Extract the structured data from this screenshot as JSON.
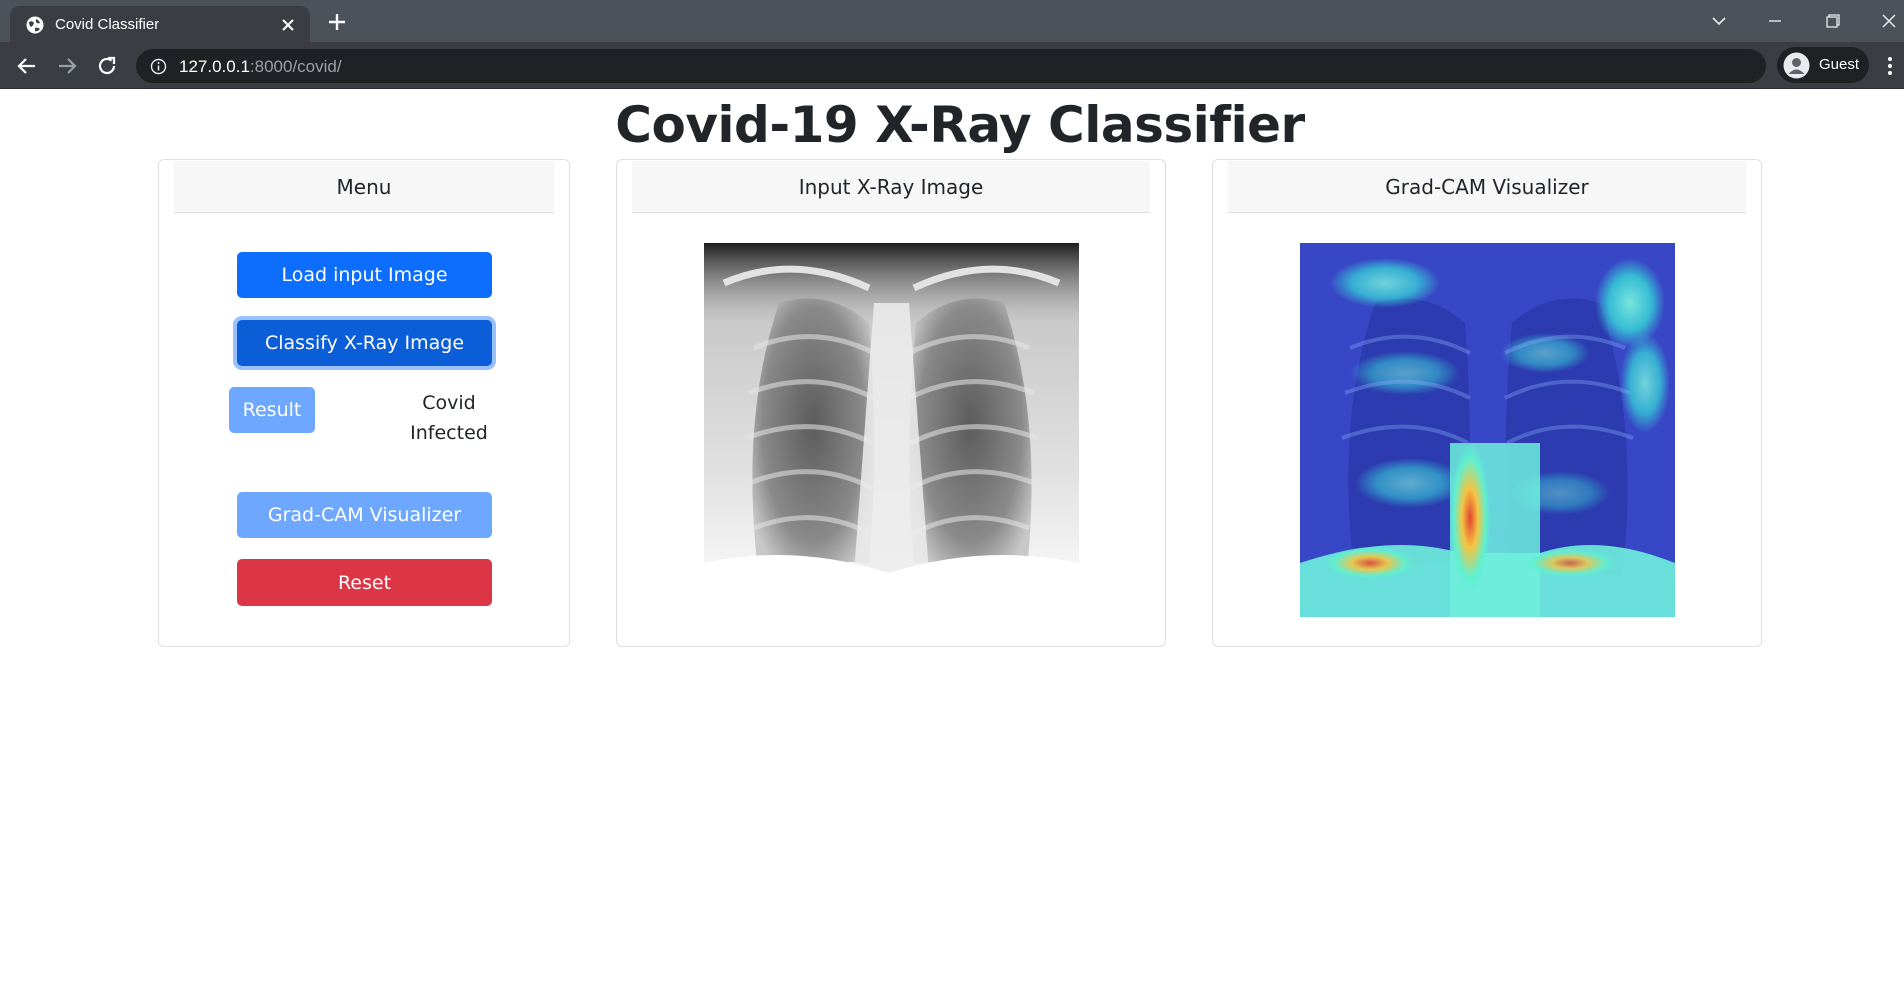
{
  "browser": {
    "tab_title": "Covid Classifier",
    "url_host": "127.0.0.1",
    "url_path": ":8000/covid/",
    "profile_name": "Guest",
    "icons": [
      "globe-icon",
      "close-icon",
      "plus-icon",
      "chevron-down-icon",
      "minimize-icon",
      "restore-icon",
      "window-close-icon",
      "back-arrow-icon",
      "forward-arrow-icon",
      "reload-icon",
      "info-icon",
      "avatar-icon",
      "kebab-menu-icon"
    ]
  },
  "page": {
    "title": "Covid-19 X-Ray Classifier"
  },
  "menu": {
    "header": "Menu",
    "load_button": "Load input Image",
    "classify_button": "Classify X-Ray Image",
    "result_button": "Result",
    "result_line1": "Covid",
    "result_line2": "Infected",
    "gradcam_button": "Grad-CAM Visualizer",
    "reset_button": "Reset"
  },
  "input_panel": {
    "header": "Input X-Ray Image"
  },
  "gradcam_panel": {
    "header": "Grad-CAM Visualizer"
  },
  "colors": {
    "primary": "#0d6efd",
    "primary_active": "#0b5ed7",
    "primary_light": "#6ea8fe",
    "danger": "#dc3545",
    "text": "#212529"
  }
}
